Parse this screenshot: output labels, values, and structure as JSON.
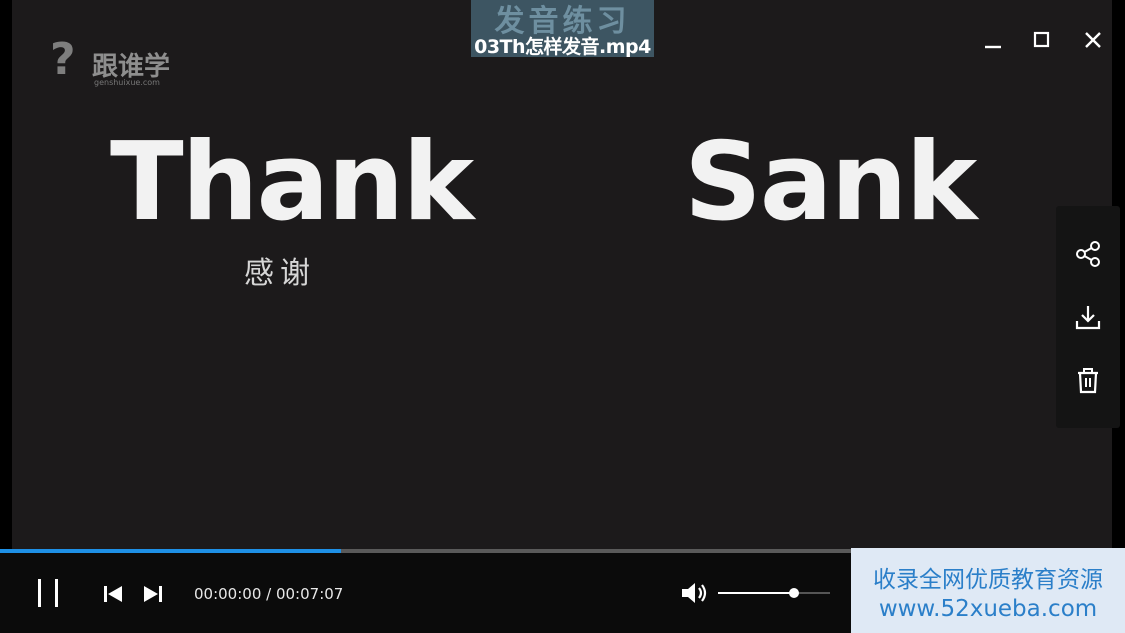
{
  "window": {
    "title": "03Th怎样发音.mp4",
    "title_bg_text": "发音练习"
  },
  "video_frame": {
    "logo": {
      "mark": "?",
      "name": "跟谁学",
      "url": "genshuixue.com"
    },
    "word_left": "Thank",
    "word_right": "Sank",
    "subtitle": "感谢"
  },
  "playback": {
    "progress_fraction": 0.4,
    "current_time": "00:00:00",
    "separator": " / ",
    "total_time": "00:07:07",
    "volume_fraction": 0.68
  },
  "watermark": {
    "line1": "收录全网优质教育资源",
    "line2": "www.52xueba.com"
  },
  "icons": {
    "minimize": "minimize-icon",
    "maximize": "maximize-icon",
    "close": "close-icon",
    "share": "share-icon",
    "download": "download-icon",
    "delete": "trash-icon",
    "pause": "pause-icon",
    "previous": "skip-previous-icon",
    "next": "skip-next-icon",
    "volume": "volume-icon"
  },
  "colors": {
    "progress": "#1e90e6",
    "video_bg": "#1c1a1b",
    "watermark_text": "#2b7fc9",
    "watermark_bg": "#dfe9f5"
  }
}
